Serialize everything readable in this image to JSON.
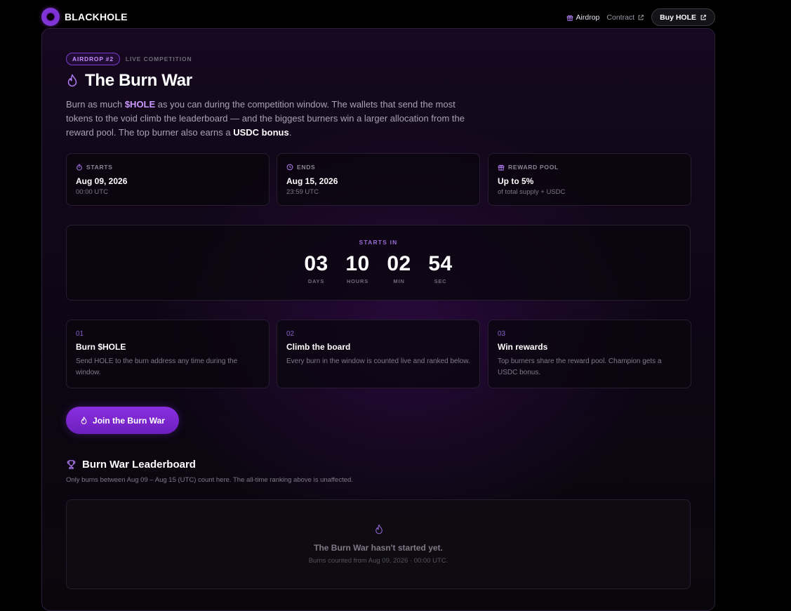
{
  "brand": {
    "name": "BLACKHOLE"
  },
  "nav": {
    "airdrop": "Airdrop",
    "contract": "Contract",
    "buy": "Buy HOLE"
  },
  "hero": {
    "badge": "AIRDROP #2",
    "badge_sub": "LIVE COMPETITION",
    "title": "The Burn War",
    "desc_1": "Burn as much ",
    "desc_token": "$HOLE",
    "desc_2": " as you can during the competition window. The wallets that send the most tokens to the void climb the leaderboard — and the biggest burners win a larger allocation from the reward pool. The top burner also earns a ",
    "desc_bonus": "USDC bonus",
    "desc_3": "."
  },
  "info": [
    {
      "label": "STARTS",
      "value": "Aug 09, 2026",
      "sub": "00:00 UTC",
      "icon": "timer-icon"
    },
    {
      "label": "ENDS",
      "value": "Aug 15, 2026",
      "sub": "23:59 UTC",
      "icon": "clock-icon"
    },
    {
      "label": "REWARD POOL",
      "value": "Up to 5%",
      "sub": "of total supply + USDC",
      "icon": "gift-icon"
    }
  ],
  "countdown": {
    "label": "STARTS IN",
    "units": [
      {
        "value": "03",
        "caption": "DAYS"
      },
      {
        "value": "10",
        "caption": "HOURS"
      },
      {
        "value": "02",
        "caption": "MIN"
      },
      {
        "value": "54",
        "caption": "SEC"
      }
    ]
  },
  "steps": [
    {
      "num": "01",
      "title": "Burn $HOLE",
      "text": "Send HOLE to the burn address any time during the window."
    },
    {
      "num": "02",
      "title": "Climb the board",
      "text": "Every burn in the window is counted live and ranked below."
    },
    {
      "num": "03",
      "title": "Win rewards",
      "text": "Top burners share the reward pool. Champion gets a USDC bonus."
    }
  ],
  "join_button": "Join the Burn War",
  "leaderboard": {
    "title": "Burn War Leaderboard",
    "subtitle": "Only burns between Aug 09 – Aug 15 (UTC) count here. The all-time ranking above is unaffected.",
    "empty_title": "The Burn War hasn't started yet.",
    "empty_sub": "Burns counted from Aug 09, 2026 · 00:00 UTC."
  },
  "colors": {
    "accent": "#8a2fe0",
    "accent_light": "#c99aff",
    "background": "#000000"
  }
}
